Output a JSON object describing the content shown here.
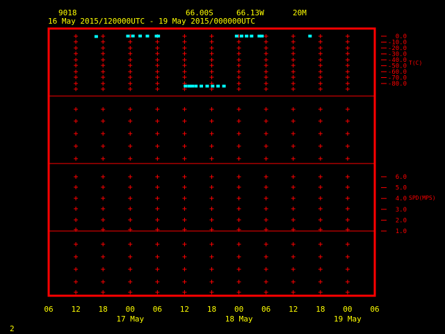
{
  "header": {
    "station": "9018",
    "lat": "66.00S",
    "lon": "66.13W",
    "level": "20M",
    "period": "16 May 2015/120000UTC - 19 May 2015/000000UTC"
  },
  "footer": {
    "page_number": "2"
  },
  "colors": {
    "background": "#000000",
    "frame": "#ff0000",
    "grid": "#ff0000",
    "labels": "#ff0000",
    "header_text": "#ffff00",
    "time_axis_text": "#ffff00",
    "data_points": "#00ffff"
  },
  "time_axis": {
    "tick_labels": [
      "06",
      "12",
      "18",
      "00",
      "06",
      "12",
      "18",
      "00",
      "06",
      "12",
      "18",
      "00",
      "06"
    ],
    "date_labels": [
      {
        "text": "17 May",
        "hour": 18
      },
      {
        "text": "18 May",
        "hour": 42
      },
      {
        "text": "19 May",
        "hour": 66
      }
    ]
  },
  "chart_data": [
    {
      "type": "scatter",
      "panel": "temperature",
      "ylabel": "T(C)",
      "y_ticks": [
        "0.0",
        "-10.0",
        "-20.0",
        "-30.0",
        "-40.0",
        "-50.0",
        "-60.0",
        "-70.0",
        "-80.0"
      ],
      "ylim": [
        -80,
        0
      ],
      "x_unit": "hours after 16 May 2015 06 UTC",
      "points": [
        {
          "x": 10.5,
          "y": -0.5
        },
        {
          "x": 17.5,
          "y": 0.2
        },
        {
          "x": 18.6,
          "y": 0.3
        },
        {
          "x": 20.2,
          "y": 0.3
        },
        {
          "x": 21.8,
          "y": 0.2
        },
        {
          "x": 23.8,
          "y": 0.2
        },
        {
          "x": 24.2,
          "y": 0.2
        },
        {
          "x": 30.2,
          "y": -75.0
        },
        {
          "x": 31.0,
          "y": -75.0
        },
        {
          "x": 31.7,
          "y": -75.0
        },
        {
          "x": 32.5,
          "y": -75.0
        },
        {
          "x": 33.7,
          "y": -75.0
        },
        {
          "x": 35.0,
          "y": -75.0
        },
        {
          "x": 36.2,
          "y": -75.0
        },
        {
          "x": 37.4,
          "y": -75.0
        },
        {
          "x": 38.7,
          "y": -75.0
        },
        {
          "x": 41.5,
          "y": 0.2
        },
        {
          "x": 42.6,
          "y": 0.2
        },
        {
          "x": 43.7,
          "y": 0.2
        },
        {
          "x": 44.8,
          "y": 0.2
        },
        {
          "x": 46.5,
          "y": 0.2
        },
        {
          "x": 47.1,
          "y": 0.2
        },
        {
          "x": 57.7,
          "y": 0.2
        }
      ]
    },
    {
      "type": "scatter",
      "panel": "blank",
      "points": []
    },
    {
      "type": "scatter",
      "panel": "wind_speed",
      "ylabel": "SPD(MPS)",
      "y_ticks": [
        "6.0",
        "5.0",
        "4.0",
        "3.0",
        "2.0",
        "1.0"
      ],
      "points": []
    },
    {
      "type": "scatter",
      "panel": "blank",
      "points": []
    }
  ]
}
